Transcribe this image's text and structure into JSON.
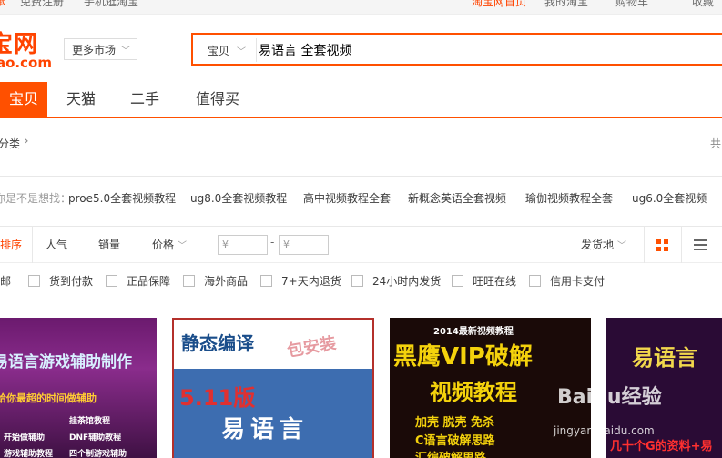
{
  "topbar": {
    "items": [
      "承",
      "免费注册",
      "手机逛淘宝",
      "淘宝网首页",
      "我的淘宝",
      "购物车",
      "收藏"
    ]
  },
  "logo": {
    "line1": "宝网",
    "line2": "ao.com"
  },
  "header": {
    "more_market": "更多市场"
  },
  "search": {
    "category": "宝贝",
    "query": "易语言 全套视频"
  },
  "tabs": [
    "宝贝",
    "天猫",
    "二手",
    "值得买"
  ],
  "category_row": {
    "label": "分类",
    "right": "共"
  },
  "suggestions": {
    "label": "你是不是想找：",
    "items": [
      "proe5.0全套视频教程",
      "ug8.0全套视频教程",
      "高中视频教程全套",
      "新概念英语全套视频",
      "瑜伽视频教程全套",
      "ug6.0全套视频"
    ]
  },
  "sortbar": {
    "default": "综合排序",
    "popularity": "人气",
    "sales": "销量",
    "price": "价格",
    "min_placeholder": "¥",
    "max_placeholder": "¥",
    "location": "发货地"
  },
  "filters": [
    "包邮",
    "货到付款",
    "正品保障",
    "海外商品",
    "7+天内退货",
    "24小时内发货",
    "旺旺在线",
    "信用卡支付"
  ],
  "products": [
    {
      "title": "易语言游戏辅助制作",
      "subtitle": "给你最超的时间做辅助",
      "lines": [
        "开始做辅助",
        "挂茶馆教程",
        "DNF辅助教程",
        "游戏辅助教程",
        "四个制游戏辅助"
      ]
    },
    {
      "title": "静态编译",
      "tag": "包安装",
      "version": "5.11版",
      "name": "易语言"
    },
    {
      "banner": "2014最新视频教程",
      "title": "黑鹰VIP破解",
      "title2": "视频教程",
      "lines": [
        "加壳 脱壳 免杀",
        "C语言破解思路",
        "汇编破解思路"
      ]
    },
    {
      "title": "易语言",
      "footer": "几十个G的资料+易"
    }
  ],
  "watermark": {
    "brand": "Baidu经验",
    "site": "jingyan.baidu.com"
  },
  "colors": {
    "accent": "#ff5000",
    "text": "#3c3c3c"
  }
}
